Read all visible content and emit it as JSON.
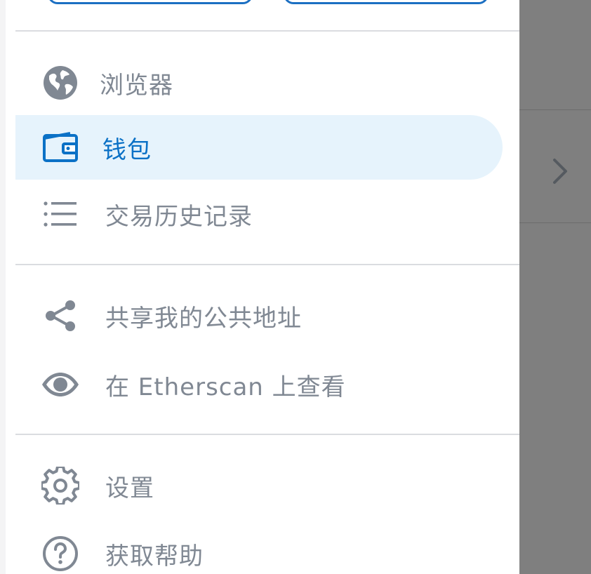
{
  "menu": {
    "items": [
      {
        "label": "浏览器",
        "icon": "globe-icon"
      },
      {
        "label": "钱包",
        "icon": "wallet-icon",
        "active": true
      },
      {
        "label": "交易历史记录",
        "icon": "list-icon"
      },
      {
        "label": "共享我的公共地址",
        "icon": "share-icon"
      },
      {
        "label": "在 Etherscan 上查看",
        "icon": "eye-icon"
      },
      {
        "label": "设置",
        "icon": "gear-icon"
      },
      {
        "label": "获取帮助",
        "icon": "help-icon"
      }
    ]
  },
  "colors": {
    "accent": "#0b71c6",
    "active_bg": "#e6f3fc",
    "icon_gray": "#808893",
    "overlay": "#7f7f7f"
  }
}
